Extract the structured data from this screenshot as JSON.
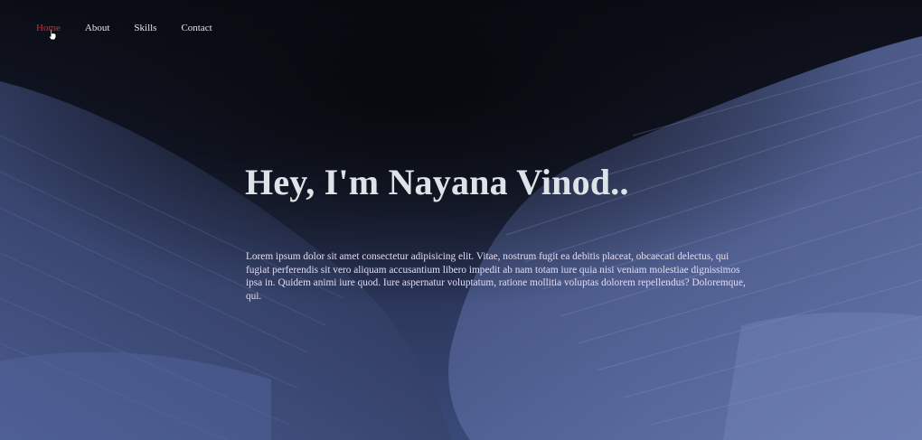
{
  "nav": {
    "items": [
      {
        "label": "Home",
        "active": true
      },
      {
        "label": "About",
        "active": false
      },
      {
        "label": "Skills",
        "active": false
      },
      {
        "label": "Contact",
        "active": false
      }
    ]
  },
  "hero": {
    "title": "Hey, I'm Nayana Vinod..",
    "intro": "Lorem ipsum dolor sit amet consectetur adipisicing elit. Vitae, nostrum fugit ea debitis placeat, obcaecati delectus, qui fugiat perferendis sit vero aliquam accusantium libero impedit ab nam totam iure quia nisi veniam molestiae dignissimos ipsa in. Quidem animi iure quod. Iure aspernatur voluptatum, ratione mollitia voluptas dolorem repellendus? Doloremque, qui."
  },
  "colors": {
    "nav_active": "#c0323a",
    "nav_text": "#dfe6f2",
    "title_text": "#dde4e8",
    "intro_text": "#e4dcef"
  },
  "icons": {
    "cursor": "hand-pointer-icon"
  }
}
